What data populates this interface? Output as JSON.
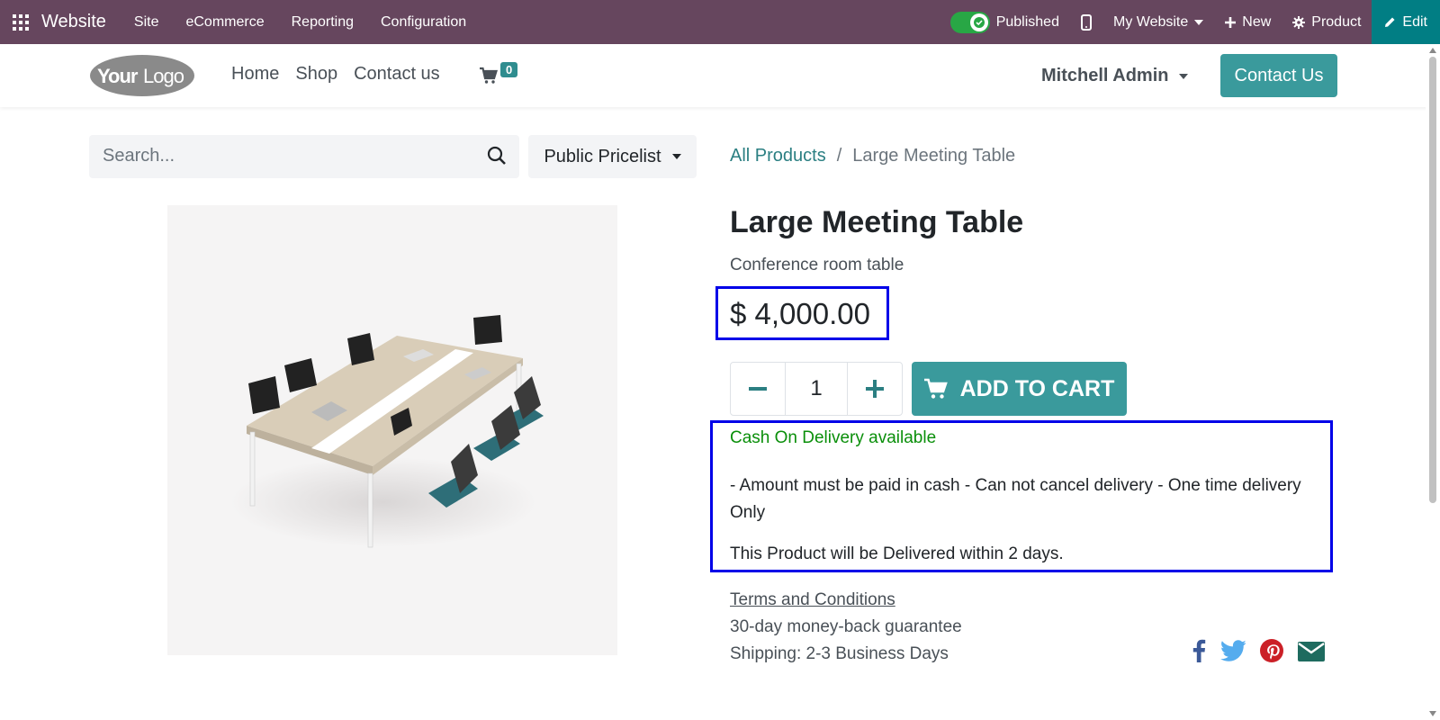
{
  "admin_bar": {
    "brand": "Website",
    "menu": [
      "Site",
      "eCommerce",
      "Reporting",
      "Configuration"
    ],
    "published_label": "Published",
    "website_label": "My Website",
    "new_label": "New",
    "product_label": "Product",
    "edit_label": "Edit",
    "colors": {
      "bar": "#66465e",
      "edit": "#017e84",
      "toggle": "#28a745"
    }
  },
  "header": {
    "logo_text": "YourLogo",
    "nav": [
      "Home",
      "Shop",
      "Contact us"
    ],
    "cart_count": "0",
    "user_name": "Mitchell Admin",
    "contact_button": "Contact Us"
  },
  "search": {
    "placeholder": "Search...",
    "pricelist": "Public Pricelist"
  },
  "breadcrumb": {
    "parent": "All Products",
    "separator": "/",
    "current": "Large Meeting Table"
  },
  "product": {
    "name": "Large Meeting Table",
    "description": "Conference room table",
    "price": "$ 4,000.00",
    "quantity": "1",
    "add_to_cart": "ADD TO CART",
    "cod_text": "Cash On Delivery available",
    "rules_text": "- Amount must be paid in cash - Can not cancel delivery - One time delivery Only",
    "delivery_text": "This Product will be Delivered within 2 days.",
    "terms": "Terms and Conditions",
    "guarantee": "30-day money-back guarantee",
    "shipping": "Shipping: 2-3 Business Days"
  },
  "share_icons": [
    "facebook-icon",
    "twitter-icon",
    "pinterest-icon",
    "envelope-icon"
  ],
  "colors": {
    "accent": "#3a9a9c",
    "highlight": "#0000e8",
    "success_text": "#0a8f0a"
  }
}
